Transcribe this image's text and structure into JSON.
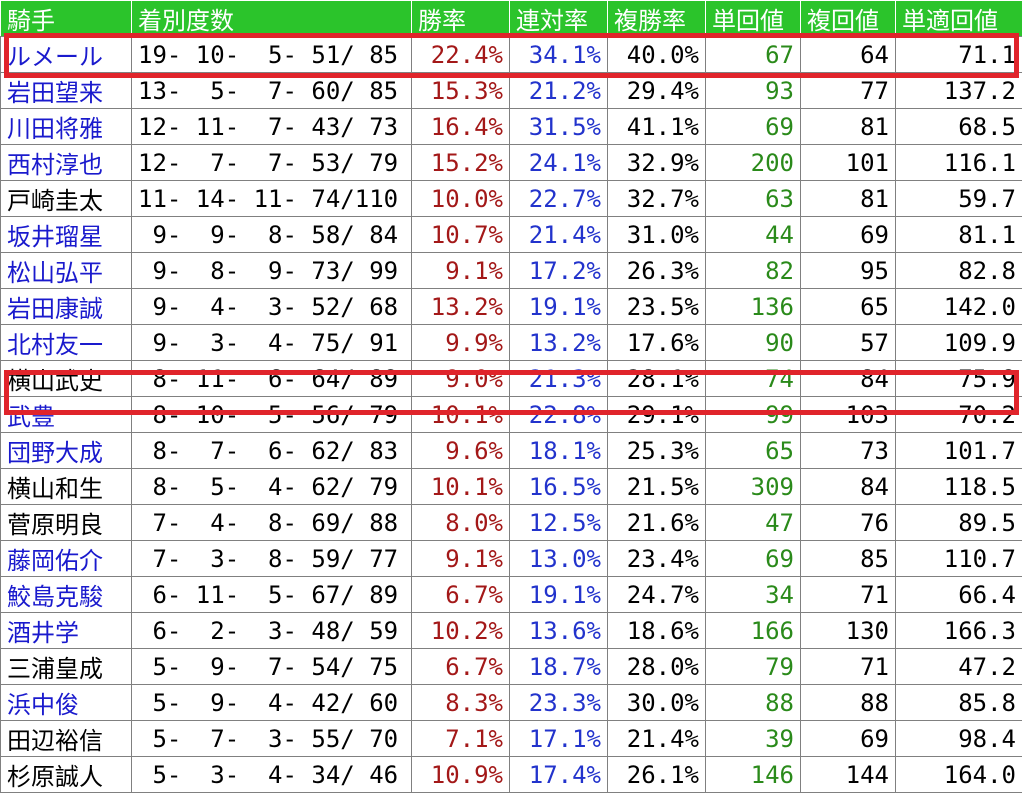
{
  "headers": [
    "騎手",
    "着別度数",
    "勝率",
    "連対率",
    "複勝率",
    "単回値",
    "複回値",
    "単適回値"
  ],
  "rows": [
    {
      "name": "ルメール",
      "link": true,
      "record": "19- 10-  5- 51/ 85",
      "win": "22.4%",
      "ren": "34.1%",
      "fuku": "40.0%",
      "tan": "67",
      "fkkai": "64",
      "tekio": "71.1"
    },
    {
      "name": "岩田望来",
      "link": true,
      "record": "13-  5-  7- 60/ 85",
      "win": "15.3%",
      "ren": "21.2%",
      "fuku": "29.4%",
      "tan": "93",
      "fkkai": "77",
      "tekio": "137.2"
    },
    {
      "name": "川田将雅",
      "link": true,
      "record": "12- 11-  7- 43/ 73",
      "win": "16.4%",
      "ren": "31.5%",
      "fuku": "41.1%",
      "tan": "69",
      "fkkai": "81",
      "tekio": "68.5"
    },
    {
      "name": "西村淳也",
      "link": true,
      "record": "12-  7-  7- 53/ 79",
      "win": "15.2%",
      "ren": "24.1%",
      "fuku": "32.9%",
      "tan": "200",
      "fkkai": "101",
      "tekio": "116.1"
    },
    {
      "name": "戸崎圭太",
      "link": false,
      "record": "11- 14- 11- 74/110",
      "win": "10.0%",
      "ren": "22.7%",
      "fuku": "32.7%",
      "tan": "63",
      "fkkai": "81",
      "tekio": "59.7"
    },
    {
      "name": "坂井瑠星",
      "link": true,
      "record": " 9-  9-  8- 58/ 84",
      "win": "10.7%",
      "ren": "21.4%",
      "fuku": "31.0%",
      "tan": "44",
      "fkkai": "69",
      "tekio": "81.1"
    },
    {
      "name": "松山弘平",
      "link": true,
      "record": " 9-  8-  9- 73/ 99",
      "win": "9.1%",
      "ren": "17.2%",
      "fuku": "26.3%",
      "tan": "82",
      "fkkai": "95",
      "tekio": "82.8"
    },
    {
      "name": "岩田康誠",
      "link": true,
      "record": " 9-  4-  3- 52/ 68",
      "win": "13.2%",
      "ren": "19.1%",
      "fuku": "23.5%",
      "tan": "136",
      "fkkai": "65",
      "tekio": "142.0"
    },
    {
      "name": "北村友一",
      "link": true,
      "record": " 9-  3-  4- 75/ 91",
      "win": "9.9%",
      "ren": "13.2%",
      "fuku": "17.6%",
      "tan": "90",
      "fkkai": "57",
      "tekio": "109.9"
    },
    {
      "name": "横山武史",
      "link": false,
      "record": " 8- 11-  6- 64/ 89",
      "win": "9.0%",
      "ren": "21.3%",
      "fuku": "28.1%",
      "tan": "74",
      "fkkai": "84",
      "tekio": "75.9"
    },
    {
      "name": "武豊",
      "link": true,
      "record": " 8- 10-  5- 56/ 79",
      "win": "10.1%",
      "ren": "22.8%",
      "fuku": "29.1%",
      "tan": "99",
      "fkkai": "103",
      "tekio": "70.2"
    },
    {
      "name": "団野大成",
      "link": true,
      "record": " 8-  7-  6- 62/ 83",
      "win": "9.6%",
      "ren": "18.1%",
      "fuku": "25.3%",
      "tan": "65",
      "fkkai": "73",
      "tekio": "101.7"
    },
    {
      "name": "横山和生",
      "link": false,
      "record": " 8-  5-  4- 62/ 79",
      "win": "10.1%",
      "ren": "16.5%",
      "fuku": "21.5%",
      "tan": "309",
      "fkkai": "84",
      "tekio": "118.5"
    },
    {
      "name": "菅原明良",
      "link": false,
      "record": " 7-  4-  8- 69/ 88",
      "win": "8.0%",
      "ren": "12.5%",
      "fuku": "21.6%",
      "tan": "47",
      "fkkai": "76",
      "tekio": "89.5"
    },
    {
      "name": "藤岡佑介",
      "link": true,
      "record": " 7-  3-  8- 59/ 77",
      "win": "9.1%",
      "ren": "13.0%",
      "fuku": "23.4%",
      "tan": "69",
      "fkkai": "85",
      "tekio": "110.7"
    },
    {
      "name": "鮫島克駿",
      "link": true,
      "record": " 6- 11-  5- 67/ 89",
      "win": "6.7%",
      "ren": "19.1%",
      "fuku": "24.7%",
      "tan": "34",
      "fkkai": "71",
      "tekio": "66.4"
    },
    {
      "name": "酒井学",
      "link": true,
      "record": " 6-  2-  3- 48/ 59",
      "win": "10.2%",
      "ren": "13.6%",
      "fuku": "18.6%",
      "tan": "166",
      "fkkai": "130",
      "tekio": "166.3"
    },
    {
      "name": "三浦皇成",
      "link": false,
      "record": " 5-  9-  7- 54/ 75",
      "win": "6.7%",
      "ren": "18.7%",
      "fuku": "28.0%",
      "tan": "79",
      "fkkai": "71",
      "tekio": "47.2"
    },
    {
      "name": "浜中俊",
      "link": true,
      "record": " 5-  9-  4- 42/ 60",
      "win": "8.3%",
      "ren": "23.3%",
      "fuku": "30.0%",
      "tan": "88",
      "fkkai": "88",
      "tekio": "85.8"
    },
    {
      "name": "田辺裕信",
      "link": false,
      "record": " 5-  7-  3- 55/ 70",
      "win": "7.1%",
      "ren": "17.1%",
      "fuku": "21.4%",
      "tan": "39",
      "fkkai": "69",
      "tekio": "98.4"
    },
    {
      "name": "杉原誠人",
      "link": false,
      "record": " 5-  3-  4- 34/ 46",
      "win": "10.9%",
      "ren": "17.4%",
      "fuku": "26.1%",
      "tan": "146",
      "fkkai": "144",
      "tekio": "164.0"
    }
  ],
  "highlighted_rows": [
    "ルメール",
    "武豊"
  ],
  "colors": {
    "header_bg": "#2bc42b",
    "header_text": "#ffffff",
    "link": "#1a1acd",
    "win_rate": "#a31818",
    "ren_rate": "#2233cc",
    "tan_value": "#2a8a1a",
    "highlight": "#e0242b"
  }
}
